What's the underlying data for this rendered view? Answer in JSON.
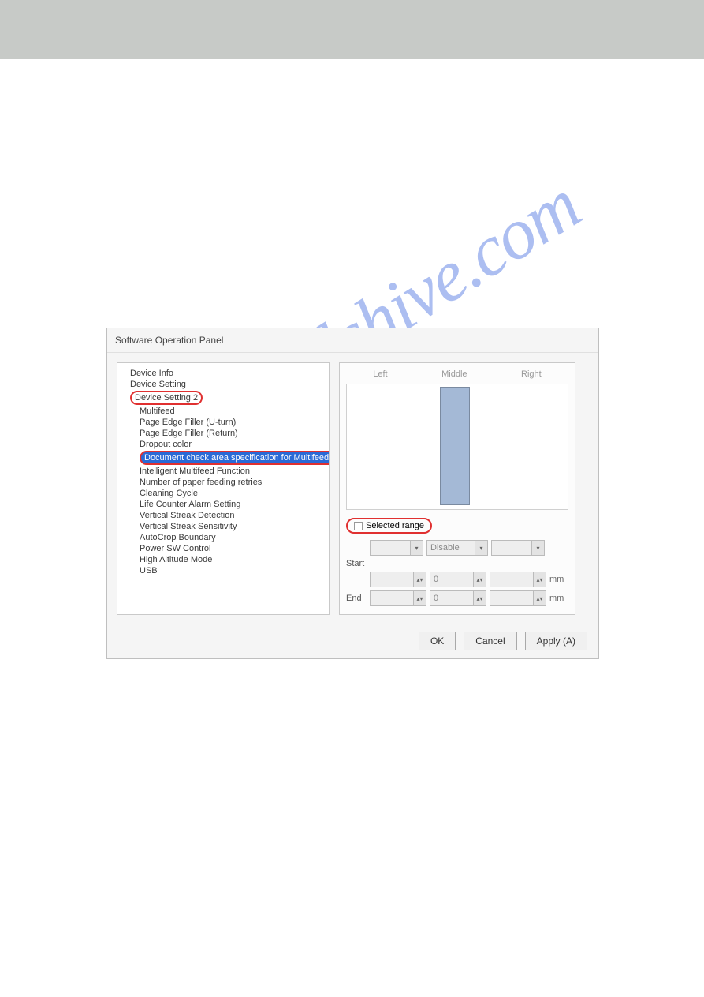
{
  "dialog": {
    "title": "Software Operation Panel"
  },
  "tree": {
    "items": [
      "Device Info",
      "Device Setting",
      "Device Setting 2",
      "Multifeed",
      "Page Edge Filler (U-turn)",
      "Page Edge Filler (Return)",
      "Dropout color",
      "Document check area specification for Multifeed Detection",
      "Intelligent Multifeed Function",
      "Number of paper feeding retries",
      "Cleaning Cycle",
      "Life Counter Alarm Setting",
      "Vertical Streak Detection",
      "Vertical Streak Sensitivity",
      "AutoCrop Boundary",
      "Power SW Control",
      "High Altitude Mode",
      "USB"
    ]
  },
  "right": {
    "cols": {
      "left": "Left",
      "middle": "Middle",
      "right": "Right"
    },
    "selected_range": "Selected range",
    "disable": "Disable",
    "start": "Start",
    "end": "End",
    "zero": "0",
    "unit": "mm"
  },
  "buttons": {
    "ok": "OK",
    "cancel": "Cancel",
    "apply": "Apply (A)"
  },
  "watermark": "manualshive.com"
}
